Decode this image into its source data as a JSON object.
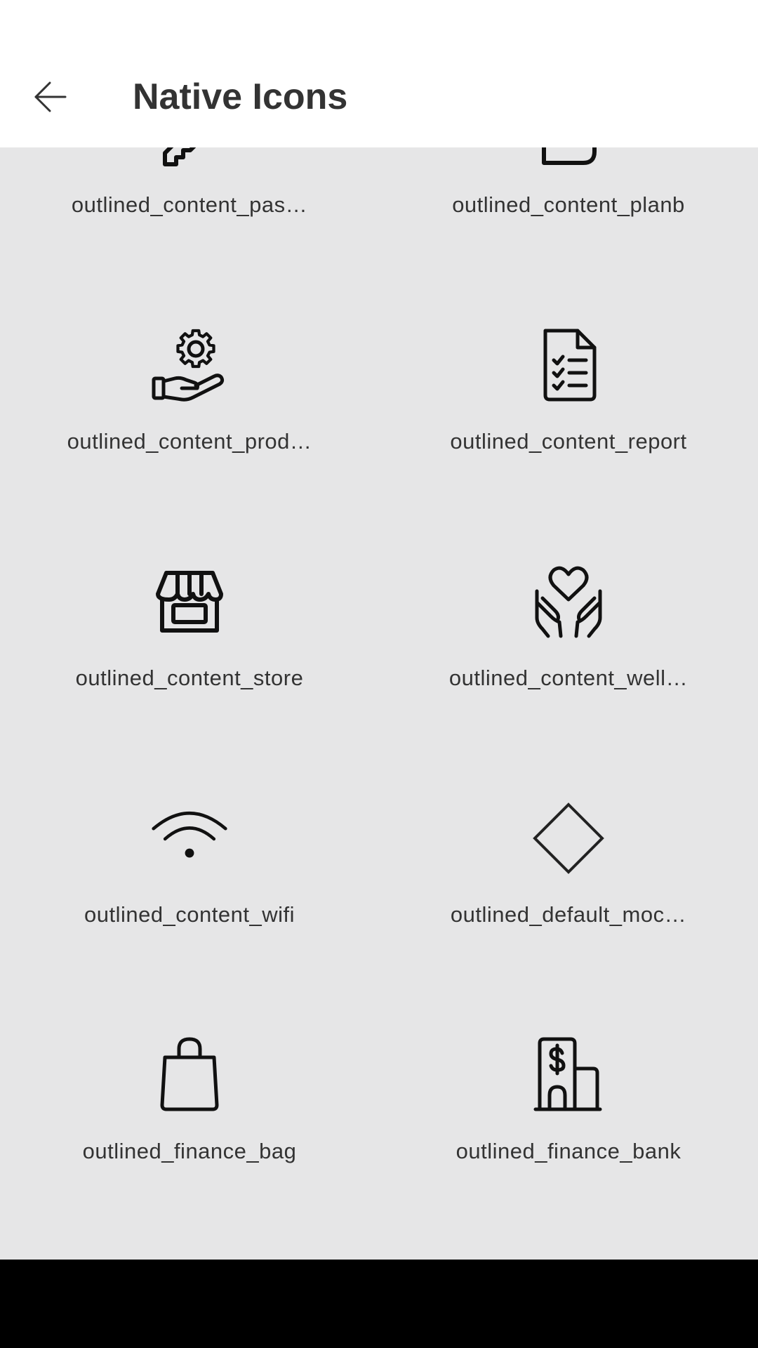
{
  "header": {
    "title": "Native Icons",
    "back_icon": "arrow-left-icon"
  },
  "colors": {
    "header_bg": "#ffffff",
    "content_bg": "#e6e6e7",
    "text": "#333333",
    "icon": "#111111",
    "nav_bar": "#000000"
  },
  "icons": [
    {
      "label": "outlined_content_pas…",
      "icon": "password-icon"
    },
    {
      "label": "outlined_content_planb",
      "icon": "planb-icon"
    },
    {
      "label": "outlined_content_prod…",
      "icon": "hand-gear-icon"
    },
    {
      "label": "outlined_content_report",
      "icon": "report-document-icon"
    },
    {
      "label": "outlined_content_store",
      "icon": "store-icon"
    },
    {
      "label": "outlined_content_well…",
      "icon": "hands-heart-icon"
    },
    {
      "label": "outlined_content_wifi",
      "icon": "wifi-icon"
    },
    {
      "label": "outlined_default_moc…",
      "icon": "diamond-icon"
    },
    {
      "label": "outlined_finance_bag",
      "icon": "shopping-bag-icon"
    },
    {
      "label": "outlined_finance_bank",
      "icon": "bank-building-icon"
    }
  ]
}
